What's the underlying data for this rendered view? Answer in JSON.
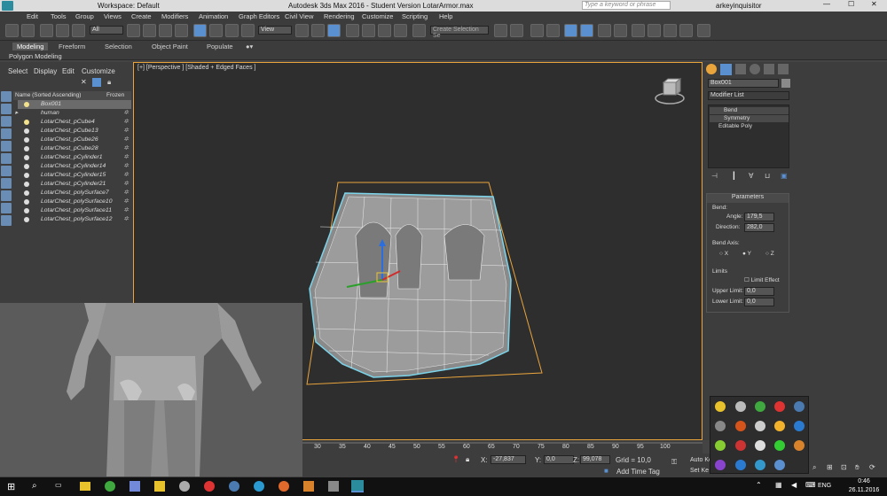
{
  "titlebar": {
    "workspace": "Workspace: Default",
    "title": "Autodesk 3ds Max 2016 - Student Version    LotarArmor.max",
    "search_placeholder": "Type a keyword or phrase",
    "user": "arkeyinquisitor"
  },
  "menubar": {
    "items": [
      "Edit",
      "Tools",
      "Group",
      "Views",
      "Create",
      "Modifiers",
      "Animation",
      "Graph Editors",
      "Civil View",
      "Rendering",
      "Customize",
      "Scripting",
      "Help"
    ]
  },
  "toolbar": {
    "filter_value": "All",
    "view_value": "View",
    "selection_set_placeholder": "Create Selection Se"
  },
  "ribbon": {
    "tabs": [
      "Modeling",
      "Freeform",
      "Selection",
      "Object Paint",
      "Populate"
    ],
    "sublabel": "Polygon Modeling"
  },
  "scene_explorer": {
    "menu": [
      "Select",
      "Display",
      "Edit",
      "Customize"
    ],
    "col_name": "Name (Sorted Ascending)",
    "col_frozen": "Frozen",
    "items": [
      {
        "name": "Box001",
        "selected": true
      },
      {
        "name": "human"
      },
      {
        "name": "LotarChest_pCube4"
      },
      {
        "name": "LotarChest_pCube13"
      },
      {
        "name": "LotarChest_pCube26"
      },
      {
        "name": "LotarChest_pCube28"
      },
      {
        "name": "LotarChest_pCylinder1"
      },
      {
        "name": "LotarChest_pCylinder14"
      },
      {
        "name": "LotarChest_pCylinder15"
      },
      {
        "name": "LotarChest_pCylinder21"
      },
      {
        "name": "LotarChest_polySurface7"
      },
      {
        "name": "LotarChest_polySurface10"
      },
      {
        "name": "LotarChest_polySurface11"
      },
      {
        "name": "LotarChest_polySurface12"
      }
    ]
  },
  "viewport": {
    "label": "[+] [Perspective ] [Shaded + Edged Faces ]"
  },
  "timeline": {
    "ticks": [
      "30",
      "35",
      "40",
      "45",
      "50",
      "55",
      "60",
      "65",
      "70",
      "75",
      "80",
      "85",
      "90",
      "95",
      "100"
    ]
  },
  "status": {
    "x_label": "X:",
    "x_value": "-27,837",
    "y_label": "Y:",
    "y_value": "0,0",
    "z_label": "Z:",
    "z_value": "99,078",
    "grid": "Grid = 10,0",
    "add_time_tag": "Add Time Tag",
    "auto_key": "Auto Ke",
    "set_key": "Set Ke"
  },
  "command_panel": {
    "object_name": "Box001",
    "modifier_list": "Modifier List",
    "stack": [
      "Bend",
      "Symmetry",
      "Editable Poly"
    ],
    "parameters_title": "Parameters",
    "bend_group": "Bend:",
    "angle_label": "Angle:",
    "angle_value": "179,5",
    "direction_label": "Direction:",
    "direction_value": "282,0",
    "bend_axis_group": "Bend Axis:",
    "axis_x": "X",
    "axis_y": "Y",
    "axis_z": "Z",
    "limits_group": "Limits",
    "limit_effect": "Limit Effect",
    "upper_label": "Upper Limit:",
    "upper_value": "0,0",
    "lower_label": "Lower Limit:",
    "lower_value": "0,0"
  },
  "taskbar": {
    "lang": "ENG",
    "time": "0:46",
    "date": "26.11.2016"
  },
  "colors": {
    "accent": "#e9a43c",
    "selection_blue": "#5a8fd0"
  }
}
